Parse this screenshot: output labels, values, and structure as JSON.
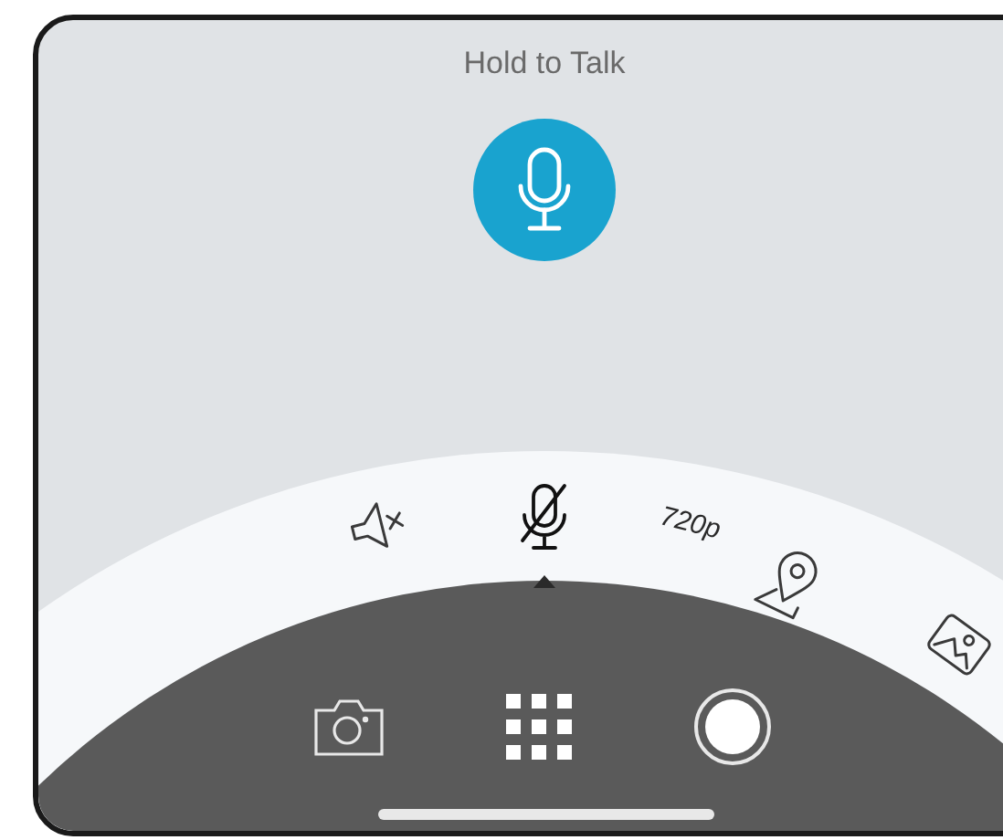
{
  "header": {
    "title": "Hold to Talk"
  },
  "dial": [
    {
      "kind": "speaker-muted",
      "selected": false
    },
    {
      "kind": "mic-off",
      "selected": true
    },
    {
      "kind": "text",
      "label": "720p",
      "selected": false
    },
    {
      "kind": "location",
      "selected": false
    },
    {
      "kind": "photo",
      "selected": false
    }
  ],
  "toolbar": [
    {
      "kind": "camera"
    },
    {
      "kind": "grid"
    },
    {
      "kind": "record"
    }
  ]
}
